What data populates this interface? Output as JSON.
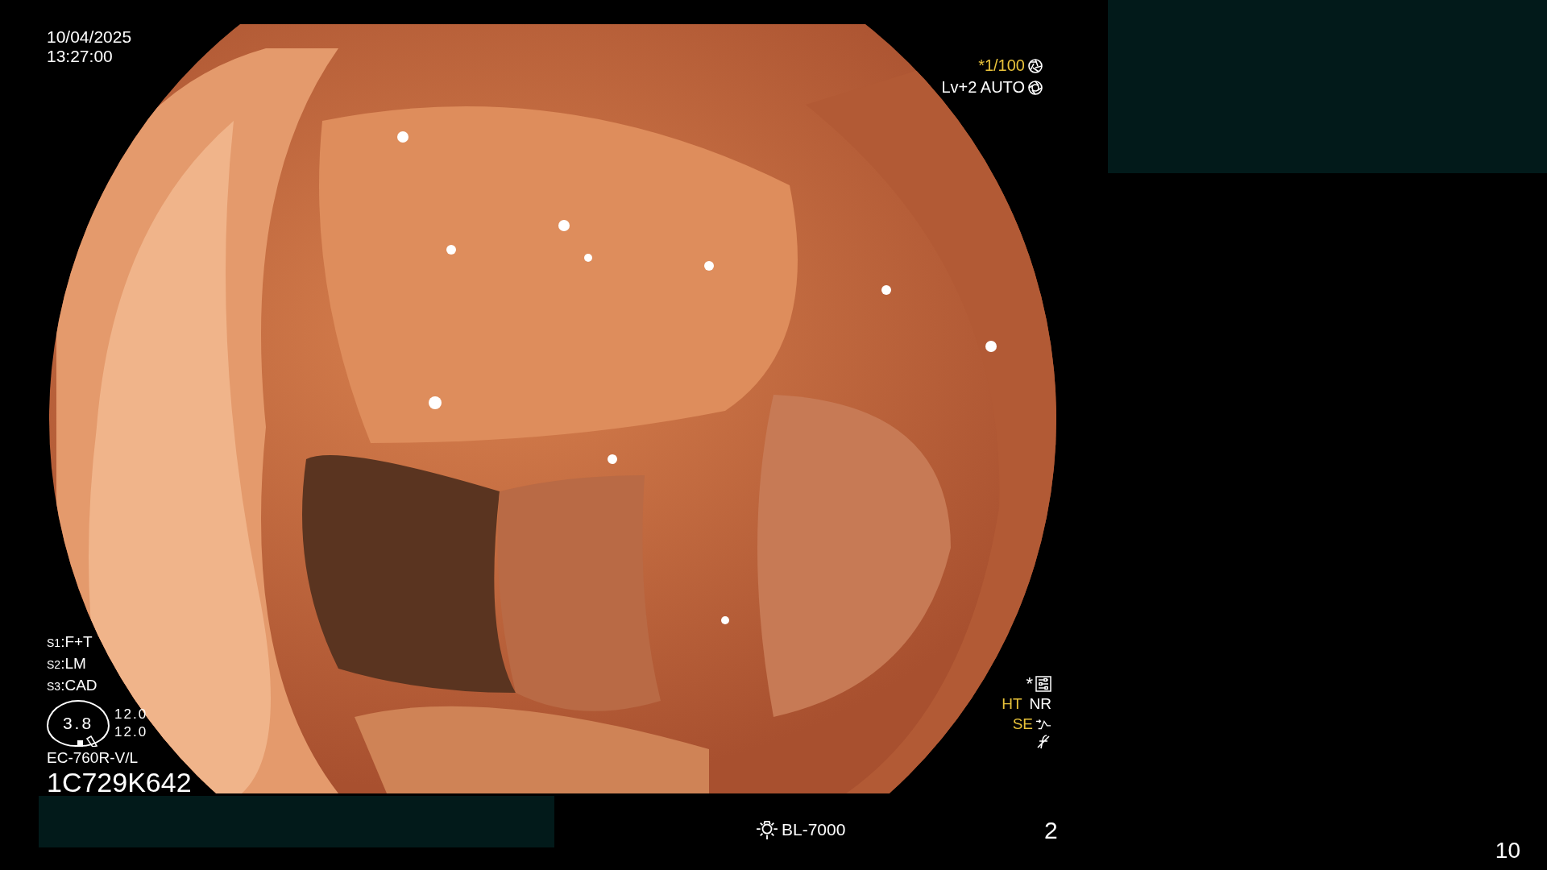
{
  "timestamp": {
    "date": "10/04/2025",
    "time": "13:27:00"
  },
  "exposure": {
    "shutter": "*1/100",
    "brightness": "Lv+2 AUTO"
  },
  "scope_settings": [
    {
      "label": "S1",
      "value": ":F+T"
    },
    {
      "label": "S2",
      "value": ":LM"
    },
    {
      "label": "S3",
      "value": ":CAD"
    }
  ],
  "gauge": {
    "value": "3.8",
    "readings": [
      "12.0",
      "12.0"
    ]
  },
  "scope_model": "EC-760R-V/L",
  "serial": "1C729K642",
  "processing": {
    "mark": "*",
    "modes": [
      {
        "text": "HT",
        "color": "#e8c23a"
      },
      {
        "text": "NR",
        "color": "#ffffff"
      }
    ],
    "se": {
      "text": "SE",
      "color": "#e8c23a"
    }
  },
  "light_source": "BL-7000",
  "page": "2",
  "frame_count": "10"
}
